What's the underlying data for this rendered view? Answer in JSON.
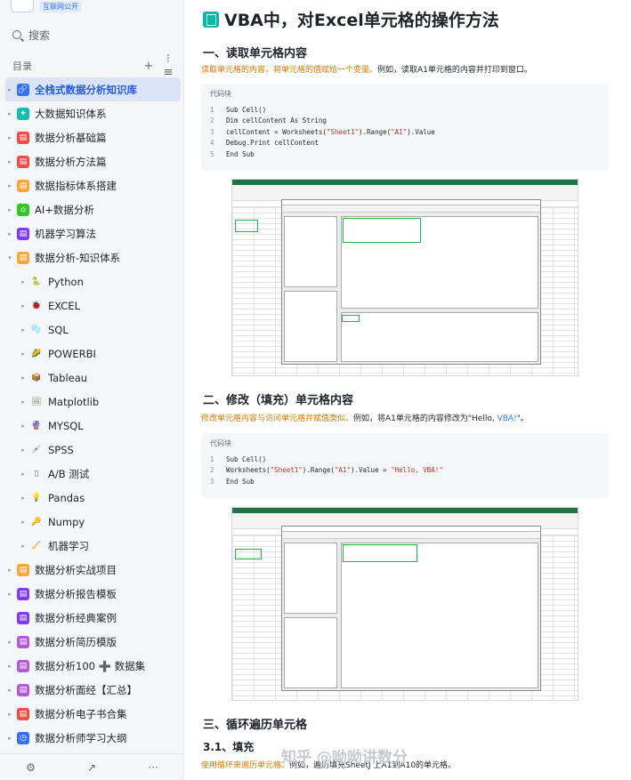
{
  "sidebar": {
    "brand_tag": "互联网公开",
    "search_placeholder": "搜索",
    "toc_label": "目录",
    "toc_add": "+",
    "toc_menu": "⁝≡",
    "items": [
      {
        "label": "全栈式数据分析知识库",
        "icon": "link-icon",
        "color": "#3370ff",
        "glyph": "🔗",
        "caret": "▸",
        "active": true
      },
      {
        "label": "大数据知识体系",
        "icon": "star-icon",
        "color": "#14c0ad",
        "glyph": "✦",
        "caret": "▸"
      },
      {
        "label": "数据分析基础篇",
        "icon": "doc-icon",
        "color": "#f54a45",
        "glyph": "▤",
        "caret": "▸"
      },
      {
        "label": "数据分析方法篇",
        "icon": "doc-icon",
        "color": "#f54a45",
        "glyph": "▤",
        "caret": "▸"
      },
      {
        "label": "数据指标体系搭建",
        "icon": "doc-icon",
        "color": "#ffa53d",
        "glyph": "▤",
        "caret": "▸"
      },
      {
        "label": "AI+数据分析",
        "icon": "home-icon",
        "color": "#34c724",
        "glyph": "⌂",
        "caret": "▸"
      },
      {
        "label": "机器学习算法",
        "icon": "doc-icon",
        "color": "#7f3bf5",
        "glyph": "▤",
        "caret": "▸"
      },
      {
        "label": "数据分析-知识体系",
        "icon": "doc-icon",
        "color": "#ffa53d",
        "glyph": "▤",
        "caret": "▾"
      },
      {
        "label": "Python",
        "icon": "python-icon",
        "color": "#8dc21f",
        "glyph": "🐍",
        "caret": "▸",
        "sub": true
      },
      {
        "label": "EXCEL",
        "icon": "ladybug-icon",
        "color": "#e03e3e",
        "glyph": "🐞",
        "caret": "▸",
        "sub": true
      },
      {
        "label": "SQL",
        "icon": "bubbles-icon",
        "color": "#3ba0ff",
        "glyph": "🫧",
        "caret": "▸",
        "sub": true
      },
      {
        "label": "POWERBI",
        "icon": "corn-icon",
        "color": "#f5b800",
        "glyph": "🌽",
        "caret": "▸",
        "sub": true
      },
      {
        "label": "Tableau",
        "icon": "box-icon",
        "color": "#c8813a",
        "glyph": "📦",
        "caret": "▸",
        "sub": true
      },
      {
        "label": "Matplotlib",
        "icon": "picture-icon",
        "color": "#7a8a5a",
        "glyph": "🖼",
        "caret": "▸",
        "sub": true
      },
      {
        "label": "MYSQL",
        "icon": "crystal-ball-icon",
        "color": "#9b4bd8",
        "glyph": "🔮",
        "caret": "▸",
        "sub": true
      },
      {
        "label": "SPSS",
        "icon": "syringe-icon",
        "color": "#4a7fc9",
        "glyph": "💉",
        "caret": "▸",
        "sub": true
      },
      {
        "label": "A/B 测试",
        "icon": "phone-icon",
        "color": "#646a73",
        "glyph": "▯",
        "caret": "▸",
        "sub": true
      },
      {
        "label": "Pandas",
        "icon": "bulb-icon",
        "color": "#f7c948",
        "glyph": "💡",
        "caret": "▸",
        "sub": true
      },
      {
        "label": "Numpy",
        "icon": "key-icon",
        "color": "#e0a92b",
        "glyph": "🔑",
        "caret": "▸",
        "sub": true
      },
      {
        "label": "机器学习",
        "icon": "broom-icon",
        "color": "#b36b2e",
        "glyph": "🧹",
        "caret": "▸",
        "sub": true
      },
      {
        "label": "数据分析实战项目",
        "icon": "doc-icon",
        "color": "#ffa53d",
        "glyph": "▤",
        "caret": "▸"
      },
      {
        "label": "数据分析报告模板",
        "icon": "doc-icon",
        "color": "#7f3bf5",
        "glyph": "▤",
        "caret": "▸"
      },
      {
        "label": "数据分析经典案例",
        "icon": "doc-icon",
        "color": "#7f3bf5",
        "glyph": "▤",
        "caret": ""
      },
      {
        "label": "数据分析简历模版",
        "icon": "doc-icon",
        "color": "#b45ad8",
        "glyph": "▤",
        "caret": "▸"
      },
      {
        "label": "数据分析100 ➕ 数据集",
        "icon": "doc-icon",
        "color": "#b45ad8",
        "glyph": "▤",
        "caret": "▸"
      },
      {
        "label": "数据分析面经【汇总】",
        "icon": "doc-icon",
        "color": "#b45ad8",
        "glyph": "▤",
        "caret": "▸"
      },
      {
        "label": "数据分析电子书合集",
        "icon": "doc-icon",
        "color": "#f54a45",
        "glyph": "▤",
        "caret": "▸"
      },
      {
        "label": "数据分析师学习大纲",
        "icon": "clock-icon",
        "color": "#3370ff",
        "glyph": "◷",
        "caret": "▸"
      }
    ],
    "footer": {
      "settings": "⚙",
      "share": "↗",
      "more": "···"
    }
  },
  "main": {
    "title": "VBA中，对Excel单元格的操作方法",
    "section1": {
      "heading": "一、读取单元格内容",
      "desc_highlight": "读取单元格的内容，将单元格的值赋给一个变量。",
      "desc_rest": "例如，读取A1单元格的内容并打印到窗口。",
      "code_label": "代码块",
      "code": [
        {
          "n": "1",
          "pre": "Sub Cell()",
          "str": "",
          "mid": "",
          "str2": "",
          "post": ""
        },
        {
          "n": "2",
          "pre": "Dim cellContent As String",
          "str": "",
          "mid": "",
          "str2": "",
          "post": ""
        },
        {
          "n": "3",
          "pre": "cellContent = Worksheets(",
          "str": "\"Sheet1\"",
          "mid": ").Range(",
          "str2": "\"A1\"",
          "post": ").Value"
        },
        {
          "n": "4",
          "pre": "Debug.Print cellContent",
          "str": "",
          "mid": "",
          "str2": "",
          "post": ""
        },
        {
          "n": "5",
          "pre": "End Sub",
          "str": "",
          "mid": "",
          "str2": "",
          "post": ""
        }
      ]
    },
    "section2": {
      "heading": "二、修改（填充）单元格内容",
      "desc_highlight": "修改单元格内容与访问单元格并赋值类似。",
      "desc_rest": "例如，将A1单元格的内容修改为\"Hello, ",
      "desc_blue": "VBA!",
      "desc_end": "\"。",
      "code_label": "代码块",
      "code": [
        {
          "n": "1",
          "pre": "Sub Cell()",
          "str": "",
          "mid": "",
          "str2": "",
          "post": "",
          "str3": ""
        },
        {
          "n": "2",
          "pre": "Worksheets(",
          "str": "\"Sheet1\"",
          "mid": ").Range(",
          "str2": "\"A1\"",
          "post": ").Value = ",
          "str3": "\"Hello, VBA!\""
        },
        {
          "n": "3",
          "pre": "End Sub",
          "str": "",
          "mid": "",
          "str2": "",
          "post": "",
          "str3": ""
        }
      ]
    },
    "section3": {
      "heading": "三、循环遍历单元格",
      "sub_heading": "3.1、填充",
      "desc_highlight": "使用循环来遍历单元格。",
      "desc_rest": "例如，遍历填充SheetJ 上A1到A10的单元格。"
    }
  },
  "watermark": "知乎 @呦呦讲数分"
}
